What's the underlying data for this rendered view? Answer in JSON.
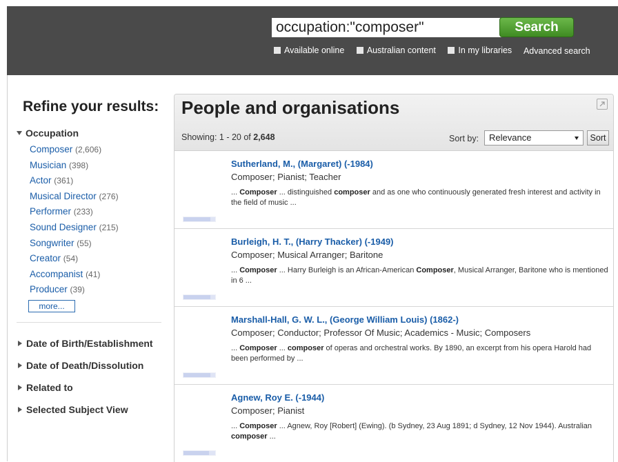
{
  "search": {
    "query": "occupation:\"composer\"",
    "button_label": "Search"
  },
  "filters": [
    {
      "label": "Available online"
    },
    {
      "label": "Australian content"
    },
    {
      "label": "In my libraries"
    }
  ],
  "advanced_search_label": "Advanced search",
  "sidebar": {
    "title": "Refine your results:",
    "occupation_heading": "Occupation",
    "occupations": [
      {
        "name": "Composer",
        "count": "(2,606)"
      },
      {
        "name": "Musician",
        "count": "(398)"
      },
      {
        "name": "Actor",
        "count": "(361)"
      },
      {
        "name": "Musical Director",
        "count": "(276)"
      },
      {
        "name": "Performer",
        "count": "(233)"
      },
      {
        "name": "Sound Designer",
        "count": "(215)"
      },
      {
        "name": "Songwriter",
        "count": "(55)"
      },
      {
        "name": "Creator",
        "count": "(54)"
      },
      {
        "name": "Accompanist",
        "count": "(41)"
      },
      {
        "name": "Producer",
        "count": "(39)"
      }
    ],
    "more_label": "more...",
    "collapsed_facets": [
      {
        "label": "Date of Birth/Establishment"
      },
      {
        "label": "Date of Death/Dissolution"
      },
      {
        "label": "Related to"
      },
      {
        "label": "Selected Subject View"
      }
    ]
  },
  "panel": {
    "title": "People and organisations",
    "showing_prefix": "Showing: 1 - 20 of ",
    "showing_total": "2,648",
    "sort_label": "Sort by:",
    "sort_value": "Relevance",
    "sort_button": "Sort"
  },
  "results": [
    {
      "name": "Sutherland, M., (Margaret) (-1984)",
      "occupations": "Composer; Pianist; Teacher",
      "snippet_html": "... <b>Composer</b> ... distinguished <b>composer</b> and as one who continuously generated fresh interest and activity in the field of music ...",
      "relevance": 0.85
    },
    {
      "name": "Burleigh, H. T., (Harry Thacker) (-1949)",
      "occupations": "Composer; Musical Arranger; Baritone",
      "snippet_html": "... <b>Composer</b> ... Harry Burleigh is an African-American <b>Composer</b>, Musical Arranger, Baritone who is mentioned in 6 ...",
      "relevance": 0.85
    },
    {
      "name": "Marshall-Hall, G. W. L., (George William Louis) (1862-)",
      "occupations": "Composer; Conductor; Professor Of Music; Academics - Music; Composers",
      "snippet_html": "... <b>Composer</b> ... <b>composer</b> of operas and orchestral works. By 1890, an excerpt from his opera Harold had been performed by ...",
      "relevance": 0.85
    },
    {
      "name": "Agnew, Roy E. (-1944)",
      "occupations": "Composer; Pianist",
      "snippet_html": "... <b>Composer</b> ... Agnew, Roy [Robert] (Ewing). (b Sydney, 23 Aug 1891; d Sydney, 12 Nov 1944). Australian <b>composer</b> ...",
      "relevance": 0.8
    }
  ]
}
